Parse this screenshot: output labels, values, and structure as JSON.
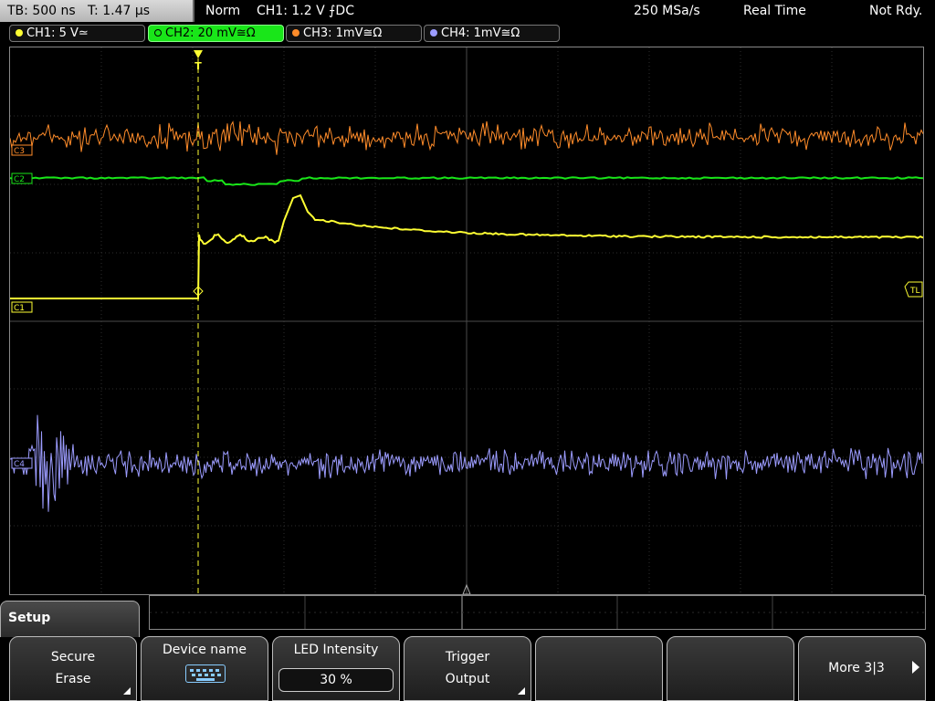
{
  "statusbar": {
    "timebase": "TB: 500 ns",
    "trigger_time": "T: 1.47 µs",
    "mode": "Norm",
    "trigger_info": "CH1: 1.2 V ⨍DC",
    "sample_rate": "250 MSa/s",
    "acq_mode": "Real Time",
    "ready_state": "Not Rdy."
  },
  "channels": [
    {
      "label": "CH1: 5 V≃",
      "color": "#ffff33",
      "active": false
    },
    {
      "label": "CH2: 20 mV≅Ω",
      "color": "#19e619",
      "active": true
    },
    {
      "label": "CH3: 1mV≅Ω",
      "color": "#ff8c2a",
      "active": false
    },
    {
      "label": "CH4: 1mV≅Ω",
      "color": "#9c9cff",
      "active": false
    }
  ],
  "markers": {
    "c1": "C1",
    "c2": "C2",
    "c3": "C3",
    "c4": "C4",
    "tl": "TL",
    "trigger": "T"
  },
  "menu": {
    "title": "Setup",
    "softkeys": [
      {
        "line1": "Secure",
        "line2": "Erase"
      },
      {
        "line1": "Device name"
      },
      {
        "line1": "LED Intensity",
        "value": "30 %"
      },
      {
        "line1": "Trigger",
        "line2": "Output"
      },
      {
        "line1": ""
      },
      {
        "line1": ""
      },
      {
        "line1": "More 3|3"
      }
    ]
  },
  "colors": {
    "grid": "#3a3a3a",
    "ch1": "#ffff33",
    "ch2": "#19e619",
    "ch3": "#ff8c2a",
    "ch4": "#9c9cff"
  }
}
